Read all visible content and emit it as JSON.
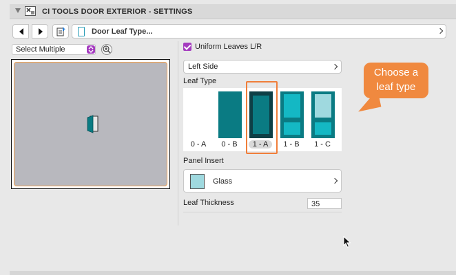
{
  "header": {
    "title": "CI TOOLS DOOR EXTERIOR - SETTINGS",
    "icon": "settings-dialog-icon"
  },
  "toolbar": {
    "nav_label": "Door Leaf Type...",
    "prev_icon": "chevron-left-icon",
    "next_icon": "chevron-right-icon",
    "favorite_icon": "favorites-icon"
  },
  "left_pane": {
    "select_label": "Select Multiple",
    "zoom_icon": "zoom-in-icon"
  },
  "right_pane": {
    "uniform_label": "Uniform Leaves L/R",
    "uniform_checked": true,
    "side_value": "Left Side",
    "leaf_type_label": "Leaf Type",
    "leaf_options": [
      {
        "label": "0 - A",
        "style": "none"
      },
      {
        "label": "0 - B",
        "style": "solid"
      },
      {
        "label": "1 - A",
        "style": "single-panel",
        "selected": true
      },
      {
        "label": "1 - B",
        "style": "two-panel"
      },
      {
        "label": "1 - C",
        "style": "two-panel-glass"
      }
    ],
    "panel_insert_label": "Panel Insert",
    "panel_insert_value": "Glass",
    "thickness_label": "Leaf Thickness",
    "thickness_value": "35"
  },
  "callout": {
    "line1": "Choose a",
    "line2": "leaf type"
  },
  "colors": {
    "accent": "#a43bbf",
    "teal": "#0a7b83",
    "callout": "#f0893f",
    "glass": "#9fd9df"
  }
}
